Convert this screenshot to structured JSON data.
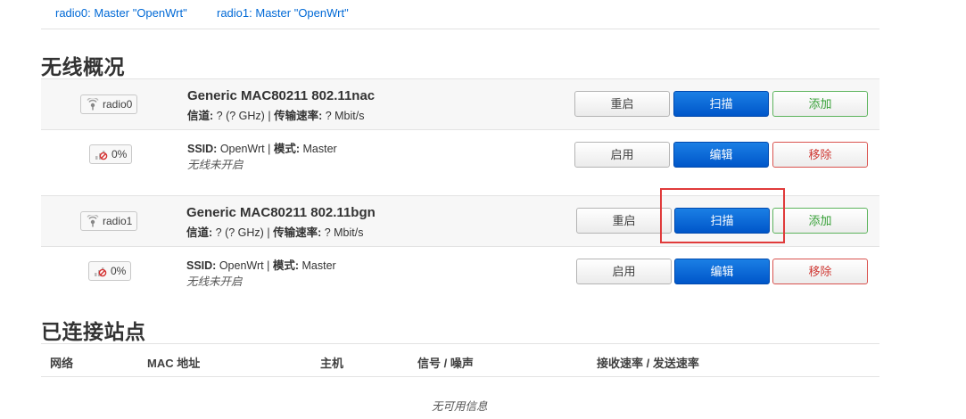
{
  "tabs": [
    "radio0: Master \"OpenWrt\"",
    "radio1: Master \"OpenWrt\""
  ],
  "overview": {
    "heading": "无线概况",
    "devices": [
      {
        "badge": "radio0",
        "title": "Generic MAC80211 802.11nac",
        "channel_label": "信道:",
        "channel_value": "? (? GHz)",
        "separator": "|",
        "rate_label": "传输速率:",
        "rate_value": "? Mbit/s",
        "buttons": {
          "restart": "重启",
          "scan": "扫描",
          "add": "添加"
        },
        "network": {
          "signal": "0%",
          "ssid_label": "SSID:",
          "ssid_value": "OpenWrt",
          "separator": "|",
          "mode_label": "模式:",
          "mode_value": "Master",
          "status": "无线未开启",
          "buttons": {
            "enable": "启用",
            "edit": "编辑",
            "remove": "移除"
          }
        }
      },
      {
        "badge": "radio1",
        "title": "Generic MAC80211 802.11bgn",
        "channel_label": "信道:",
        "channel_value": "? (? GHz)",
        "separator": "|",
        "rate_label": "传输速率:",
        "rate_value": "? Mbit/s",
        "buttons": {
          "restart": "重启",
          "scan": "扫描",
          "add": "添加"
        },
        "network": {
          "signal": "0%",
          "ssid_label": "SSID:",
          "ssid_value": "OpenWrt",
          "separator": "|",
          "mode_label": "模式:",
          "mode_value": "Master",
          "status": "无线未开启",
          "buttons": {
            "enable": "启用",
            "edit": "编辑",
            "remove": "移除"
          }
        }
      }
    ]
  },
  "stations": {
    "heading": "已连接站点",
    "columns": [
      "网络",
      "MAC 地址",
      "主机",
      "信号 / 噪声",
      "接收速率 / 发送速率"
    ],
    "empty_text": "无可用信息"
  },
  "colors": {
    "link": "#0069d6",
    "primary": "#0056c9",
    "positive": "#37a037",
    "negative": "#cf3a35",
    "highlight": "#e03b3b"
  }
}
